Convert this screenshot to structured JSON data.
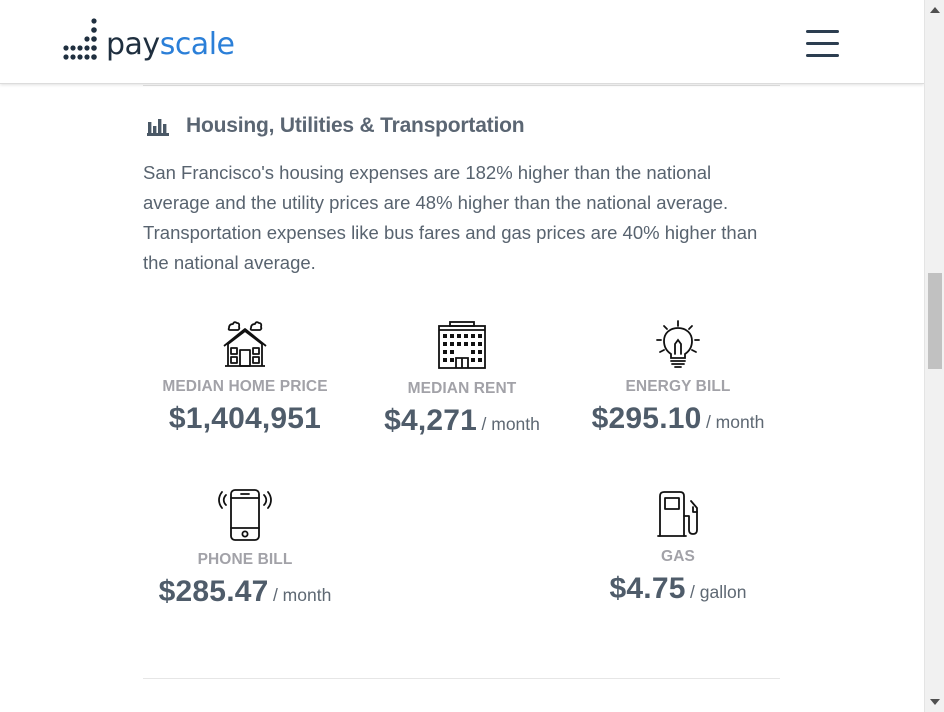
{
  "brand": {
    "logo_pay": "pay",
    "logo_scale": "scale"
  },
  "section": {
    "title": "Housing, Utilities & Transportation",
    "description": "San Francisco's housing expenses are 182% higher than the national average and the utility prices are 48% higher than the national average. Transportation expenses like bus fares and gas prices are 40% higher than the national average."
  },
  "stats": {
    "home_price": {
      "label": "MEDIAN HOME PRICE",
      "value": "$1,404,951",
      "unit": "",
      "icon": "house-icon"
    },
    "rent": {
      "label": "MEDIAN RENT",
      "value": "$4,271",
      "unit": "/ month",
      "icon": "building-icon"
    },
    "energy": {
      "label": "ENERGY BILL",
      "value": "$295.10",
      "unit": "/ month",
      "icon": "lightbulb-icon"
    },
    "phone": {
      "label": "PHONE BILL",
      "value": "$285.47",
      "unit": "/ month",
      "icon": "phone-icon"
    },
    "gas": {
      "label": "GAS",
      "value": "$4.75",
      "unit": "/ gallon",
      "icon": "gas-pump-icon"
    }
  },
  "colors": {
    "brand_dark": "#1f2f3f",
    "brand_blue": "#2b7fd8",
    "heading": "#5b6673",
    "label_gray": "#a2a2a8",
    "value": "#4f5c6a"
  }
}
